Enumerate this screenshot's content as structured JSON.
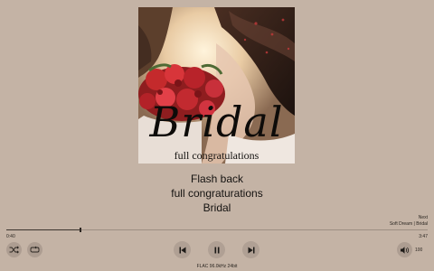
{
  "artwork": {
    "title": "Bridal",
    "subtitle": "full congratulations"
  },
  "track": {
    "title": "Flash back",
    "album": "full congraturations",
    "artist": "Bridal"
  },
  "next": {
    "label": "Next",
    "track": "Soft Dream | Bridal"
  },
  "playback": {
    "elapsed": "0:40",
    "total": "3:47",
    "progress": 0.176
  },
  "controls": {
    "shuffle_icon": "shuffle-icon",
    "repeat_icon": "repeat-icon",
    "previous_icon": "skip-previous-icon",
    "pause_icon": "pause-icon",
    "next_icon": "skip-next-icon",
    "volume_icon": "volume-icon"
  },
  "volume": {
    "value": "100"
  },
  "format": {
    "info": "FLAC 96.0kHz 24bit"
  },
  "colors": {
    "background": "#c4b3a5",
    "button": "#ad9d91",
    "text": "#141210"
  }
}
